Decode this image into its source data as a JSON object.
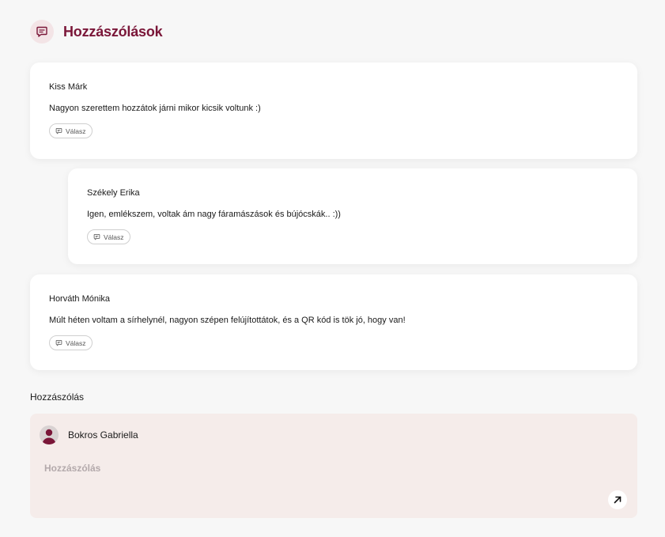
{
  "header": {
    "title": "Hozzászólások",
    "icon": "comment-icon",
    "accent_color": "#7a1638"
  },
  "comments": [
    {
      "author": "Kiss Márk",
      "text": "Nagyon szerettem hozzátok járni mikor kicsik voltunk :)",
      "reply_label": "Válasz"
    },
    {
      "author": "Székely Erika",
      "text": "Igen, emlékszem, voltak ám nagy fáramászások és bújócskák.. :))",
      "reply_label": "Válasz"
    },
    {
      "author": "Horváth Mónika",
      "text": "Múlt héten voltam a sírhelynél, nagyon szépen felújítottátok, és a QR kód is tök jó, hogy van!",
      "reply_label": "Válasz"
    }
  ],
  "composer": {
    "section_label": "Hozzászólás",
    "user_name": "Bokros Gabriella",
    "placeholder": "Hozzászólás",
    "value": "",
    "send_icon": "arrow-up-right-icon",
    "background": "#f5ecea"
  }
}
